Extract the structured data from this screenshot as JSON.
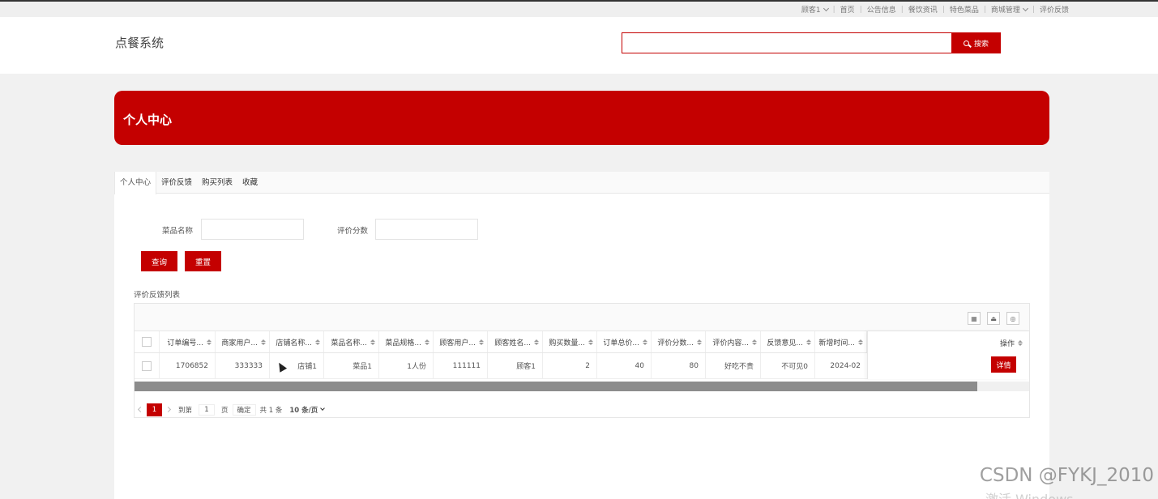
{
  "topnav": {
    "items": [
      {
        "label": "顾客1",
        "dropdown": true
      },
      {
        "label": "首页",
        "dropdown": false
      },
      {
        "label": "公告信息",
        "dropdown": false
      },
      {
        "label": "餐饮资讯",
        "dropdown": false
      },
      {
        "label": "特色菜品",
        "dropdown": false
      },
      {
        "label": "商城管理",
        "dropdown": true
      },
      {
        "label": "评价反馈",
        "dropdown": false
      }
    ]
  },
  "header": {
    "logo": "点餐系统",
    "search_placeholder": "",
    "search_button": "搜索"
  },
  "banner": {
    "title": "个人中心"
  },
  "tabs": [
    "个人中心",
    "评价反馈",
    "购买列表",
    "收藏"
  ],
  "filters": {
    "dish_name_label": "菜品名称",
    "dish_name_value": "",
    "score_label": "评价分数",
    "score_value": "",
    "query_button": "查询",
    "reset_button": "重置"
  },
  "list_title": "评价反馈列表",
  "table": {
    "headers": [
      "订单编号...",
      "商家用户...",
      "店铺名称...",
      "菜品名称...",
      "菜品规格...",
      "顾客用户...",
      "顾客姓名...",
      "购买数量...",
      "订单总价...",
      "评价分数...",
      "评价内容...",
      "反馈意见...",
      "新增时间..."
    ],
    "op_header": "操作",
    "rows": [
      [
        "1706852",
        "333333",
        "店铺1",
        "菜品1",
        "1人份",
        "111111",
        "顾客1",
        "2",
        "40",
        "80",
        "好吃不贵",
        "不可见0",
        "2024-02"
      ]
    ],
    "detail_button": "详情"
  },
  "pager": {
    "current": "1",
    "goto_label": "到第",
    "goto_value": "1",
    "page_unit": "页",
    "confirm": "确定",
    "total": "共 1 条",
    "page_size": "10 条/页"
  },
  "watermark": "CSDN @FYKJ_2010",
  "watermark2": "激活 Windows"
}
